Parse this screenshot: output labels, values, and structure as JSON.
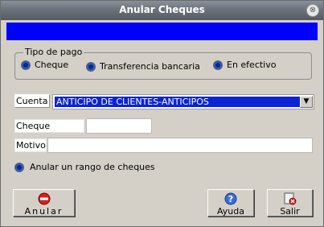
{
  "window": {
    "title": "Anular Cheques",
    "close_glyph": "⊗"
  },
  "tipo_pago": {
    "legend": "Tipo de pago",
    "options": [
      {
        "label": "Cheque"
      },
      {
        "label": "Transferencia bancaria"
      },
      {
        "label": "En efectivo"
      }
    ]
  },
  "cuenta": {
    "label": "Cuenta",
    "selected": "ANTICIPO DE CLIENTES-ANTICIPOS"
  },
  "cheque": {
    "label": "Cheque",
    "value": ""
  },
  "motivo": {
    "label": "Motivo",
    "value": ""
  },
  "rango": {
    "label": "Anular un rango de cheques"
  },
  "buttons": {
    "anular": "Anular",
    "ayuda": "Ayuda",
    "salir": "Salir"
  },
  "colors": {
    "accent_blue": "#0000ff",
    "selection": "#0a24d6",
    "face": "#d4d0c8"
  }
}
